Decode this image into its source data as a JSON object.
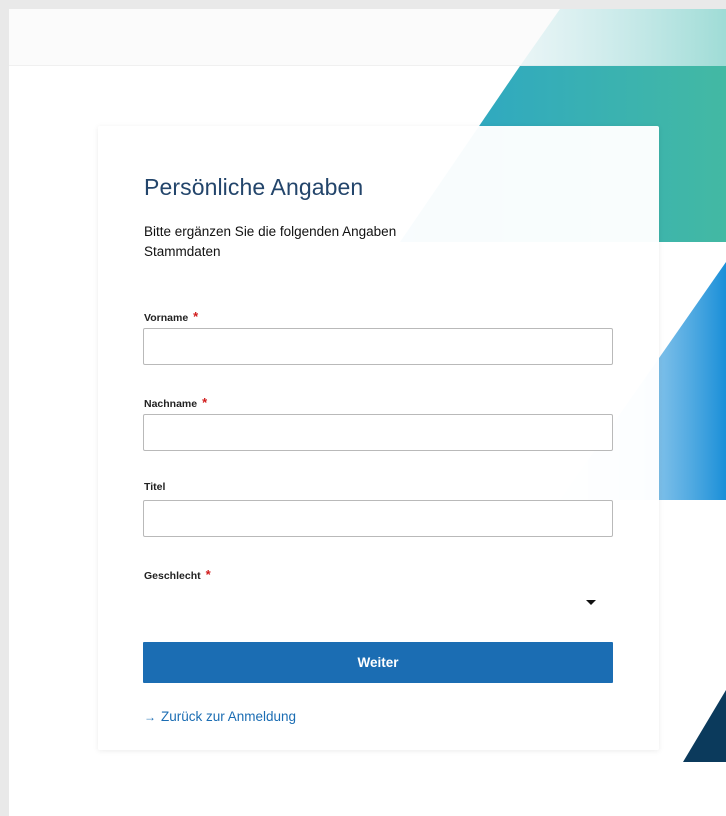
{
  "form": {
    "title": "Persönliche Angaben",
    "subtitle_line1": "Bitte ergänzen Sie die folgenden Angaben",
    "subtitle_line2": "Stammdaten",
    "required_marker": "*",
    "fields": [
      {
        "label": "Vorname",
        "required": true,
        "value": ""
      },
      {
        "label": "Nachname",
        "required": true,
        "value": ""
      },
      {
        "label": "Titel",
        "required": false,
        "value": ""
      },
      {
        "label": "Geschlecht",
        "required": true,
        "value": ""
      }
    ],
    "submit_label": "Weiter",
    "back_link": "Zurück zur Anmeldung",
    "back_icon": "→"
  },
  "colors": {
    "primary": "#1b6db3",
    "title": "#23456b",
    "required": "#d11a1a",
    "teal": "#3fb8a8",
    "blue": "#1a8fd8",
    "navy": "#0b3a5c"
  }
}
